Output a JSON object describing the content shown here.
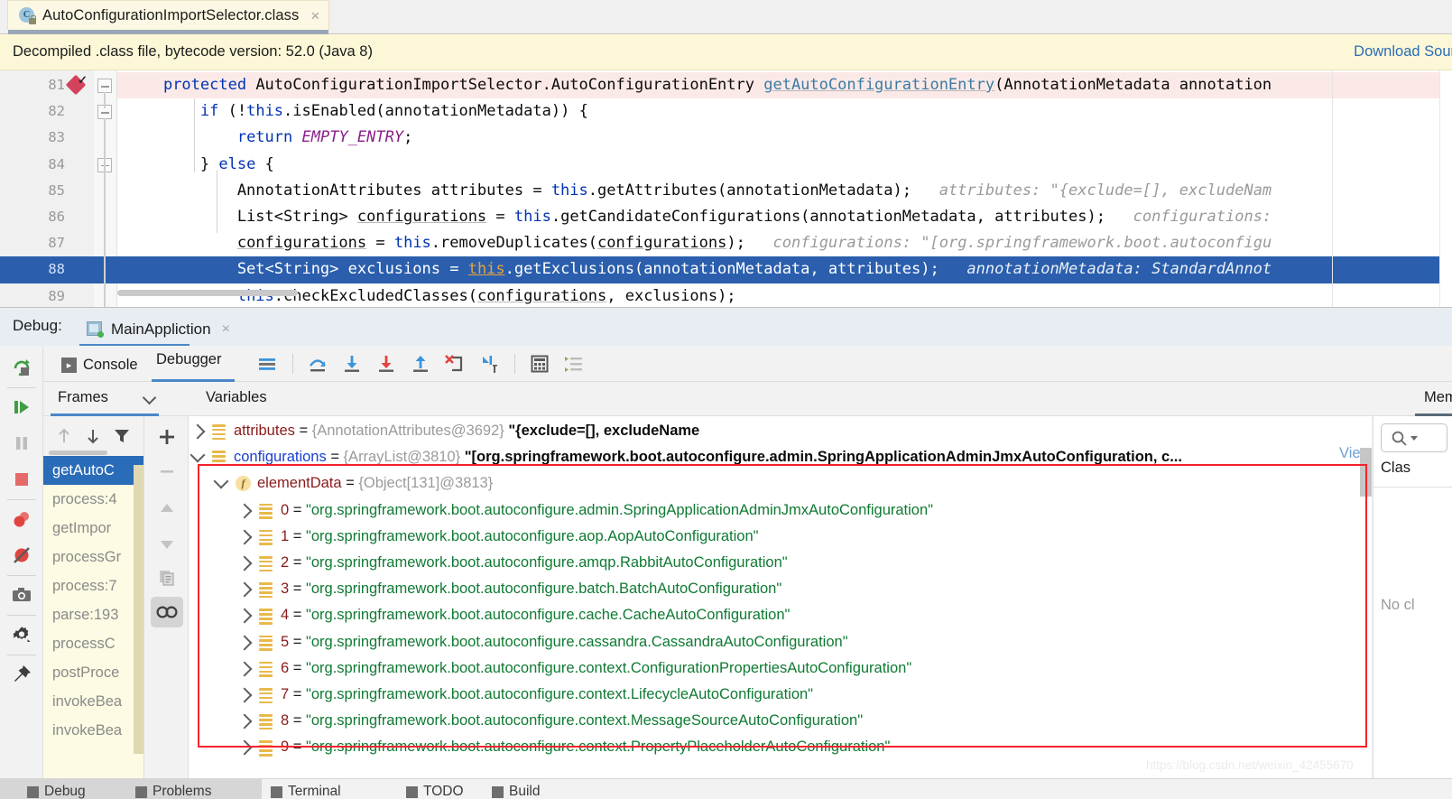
{
  "editor_tab": {
    "title": "AutoConfigurationImportSelector.class",
    "icon": "java-class-locked-icon",
    "close": "×",
    "class_letter": "C"
  },
  "notice": {
    "text": "Decompiled .class file, bytecode version: 52.0 (Java 8)",
    "link": "Download Sour"
  },
  "code": {
    "lines": [
      {
        "num": "81",
        "state": "exec",
        "breakpoint": true,
        "fold": true,
        "segments": [
          {
            "t": "    ",
            "c": "plain"
          },
          {
            "t": "protected",
            "c": "kw"
          },
          {
            "t": " AutoConfigurationImportSelector.AutoConfigurationEntry ",
            "c": "plain"
          },
          {
            "t": "getAutoConfigurationEntry",
            "c": "mth-und"
          },
          {
            "t": "(AnnotationMetadata annotation",
            "c": "plain"
          }
        ]
      },
      {
        "num": "82",
        "state": "normal",
        "breakpoint": false,
        "fold": true,
        "segments": [
          {
            "t": "        ",
            "c": "plain"
          },
          {
            "t": "if",
            "c": "kw"
          },
          {
            "t": " (!",
            "c": "plain"
          },
          {
            "t": "this",
            "c": "kw"
          },
          {
            "t": ".isEnabled(annotationMetadata)) {",
            "c": "plain"
          }
        ]
      },
      {
        "num": "83",
        "state": "normal",
        "breakpoint": false,
        "fold": false,
        "segments": [
          {
            "t": "            ",
            "c": "plain"
          },
          {
            "t": "return",
            "c": "kw"
          },
          {
            "t": " ",
            "c": "plain"
          },
          {
            "t": "EMPTY_ENTRY",
            "c": "fld"
          },
          {
            "t": ";",
            "c": "plain"
          }
        ]
      },
      {
        "num": "84",
        "state": "normal",
        "breakpoint": false,
        "fold": true,
        "segments": [
          {
            "t": "        } ",
            "c": "plain"
          },
          {
            "t": "else",
            "c": "kw"
          },
          {
            "t": " {",
            "c": "plain"
          }
        ]
      },
      {
        "num": "85",
        "state": "normal",
        "breakpoint": false,
        "fold": false,
        "segments": [
          {
            "t": "            AnnotationAttributes attributes = ",
            "c": "plain"
          },
          {
            "t": "this",
            "c": "kw"
          },
          {
            "t": ".getAttributes(annotationMetadata);   ",
            "c": "plain"
          },
          {
            "t": "attributes: \"{exclude=[], excludeNam",
            "c": "cm"
          }
        ]
      },
      {
        "num": "86",
        "state": "normal",
        "breakpoint": false,
        "fold": false,
        "segments": [
          {
            "t": "            List<String> ",
            "c": "plain"
          },
          {
            "t": "configurations",
            "c": "und"
          },
          {
            "t": " = ",
            "c": "plain"
          },
          {
            "t": "this",
            "c": "kw"
          },
          {
            "t": ".getCandidateConfigurations(annotationMetadata, attributes);   ",
            "c": "plain"
          },
          {
            "t": "configurations:",
            "c": "cm"
          }
        ]
      },
      {
        "num": "87",
        "state": "normal",
        "breakpoint": false,
        "fold": false,
        "segments": [
          {
            "t": "            ",
            "c": "plain"
          },
          {
            "t": "configurations",
            "c": "und"
          },
          {
            "t": " = ",
            "c": "plain"
          },
          {
            "t": "this",
            "c": "kw"
          },
          {
            "t": ".removeDuplicates(",
            "c": "plain"
          },
          {
            "t": "configurations",
            "c": "und"
          },
          {
            "t": ");   ",
            "c": "plain"
          },
          {
            "t": "configurations: \"[org.springframework.boot.autoconfigu",
            "c": "cm"
          }
        ]
      },
      {
        "num": "88",
        "state": "current",
        "breakpoint": false,
        "fold": false,
        "segments": [
          {
            "t": "            Set<String> exclusions = ",
            "c": "white"
          },
          {
            "t": "this",
            "c": "hl-this"
          },
          {
            "t": ".getExclusions(annotationMetadata, attributes);   ",
            "c": "white"
          },
          {
            "t": "annotationMetadata: StandardAnnot",
            "c": "white-italic"
          }
        ]
      },
      {
        "num": "89",
        "state": "normal",
        "breakpoint": false,
        "fold": false,
        "segments": [
          {
            "t": "            ",
            "c": "plain"
          },
          {
            "t": "this",
            "c": "kw"
          },
          {
            "t": ".checkExcludedClasses(",
            "c": "plain"
          },
          {
            "t": "configurations",
            "c": "und"
          },
          {
            "t": ", exclusions);",
            "c": "plain"
          }
        ]
      }
    ]
  },
  "debug": {
    "label": "Debug:",
    "session_tab": "MainAppliction",
    "session_close": "×",
    "console_tab": "Console",
    "debugger_tab": "Debugger",
    "frames_tab": "Frames",
    "variables_tab": "Variables",
    "memory_tab": "Mem",
    "toolbar_icons": [
      "mute-breakpoints-icon",
      "step-over-icon",
      "step-into-icon",
      "force-step-into-icon",
      "step-out-icon",
      "drop-frame-icon",
      "run-to-cursor-icon",
      "evaluate-expression-icon",
      "settings-lines-icon"
    ],
    "left_toolbar_icons": [
      "rerun-icon",
      "resume-program-icon",
      "pause-program-icon",
      "stop-icon",
      "view-breakpoints-icon",
      "mute-breakpoints-icon",
      "screenshot-icon",
      "settings-gear-icon",
      "pin-icon"
    ],
    "frames_toolbar_icons": [
      "up-arrow-icon",
      "down-arrow-icon",
      "filter-icon"
    ],
    "vars_toolbar_icons": [
      "add-watch-icon",
      "remove-watch-icon",
      "move-up-icon",
      "move-down-icon",
      "copy-icon",
      "inspect-icon"
    ],
    "frames": [
      {
        "label": "getAutoC",
        "selected": true
      },
      {
        "label": "process:4",
        "selected": false
      },
      {
        "label": "getImpor",
        "selected": false
      },
      {
        "label": "processGr",
        "selected": false
      },
      {
        "label": "process:7",
        "selected": false
      },
      {
        "label": "parse:193",
        "selected": false
      },
      {
        "label": "processC",
        "selected": false
      },
      {
        "label": "postProce",
        "selected": false
      },
      {
        "label": "invokeBea",
        "selected": false
      },
      {
        "label": "invokeBea",
        "selected": false
      }
    ]
  },
  "variables": {
    "view_link": "View",
    "rows": [
      {
        "indent": 0,
        "arrow": "collapsed",
        "icon": "list-icon",
        "name": "attributes",
        "name_color": "dark-red",
        "type": "{AnnotationAttributes@3692}",
        "value": "\"{exclude=[], excludeName",
        "value_color": "dark"
      },
      {
        "indent": 0,
        "arrow": "expanded",
        "icon": "list-icon",
        "name": "configurations",
        "name_color": "blue",
        "type": "{ArrayList@3810}",
        "value": "\"[org.springframework.boot.autoconfigure.admin.SpringApplicationAdminJmxAutoConfiguration, c...",
        "value_color": "dark"
      },
      {
        "indent": 1,
        "arrow": "expanded",
        "icon": "field-icon",
        "name": "elementData",
        "name_color": "dark-red",
        "type": "{Object[131]@3813}",
        "value": "",
        "value_color": "dark"
      },
      {
        "indent": 2,
        "arrow": "collapsed",
        "icon": "list-icon",
        "name": "0",
        "name_color": "dark-red",
        "type": "",
        "value": "\"org.springframework.boot.autoconfigure.admin.SpringApplicationAdminJmxAutoConfiguration\"",
        "value_color": "green"
      },
      {
        "indent": 2,
        "arrow": "collapsed",
        "icon": "list-icon",
        "name": "1",
        "name_color": "dark-red",
        "type": "",
        "value": "\"org.springframework.boot.autoconfigure.aop.AopAutoConfiguration\"",
        "value_color": "green"
      },
      {
        "indent": 2,
        "arrow": "collapsed",
        "icon": "list-icon",
        "name": "2",
        "name_color": "dark-red",
        "type": "",
        "value": "\"org.springframework.boot.autoconfigure.amqp.RabbitAutoConfiguration\"",
        "value_color": "green"
      },
      {
        "indent": 2,
        "arrow": "collapsed",
        "icon": "list-icon",
        "name": "3",
        "name_color": "dark-red",
        "type": "",
        "value": "\"org.springframework.boot.autoconfigure.batch.BatchAutoConfiguration\"",
        "value_color": "green"
      },
      {
        "indent": 2,
        "arrow": "collapsed",
        "icon": "list-icon",
        "name": "4",
        "name_color": "dark-red",
        "type": "",
        "value": "\"org.springframework.boot.autoconfigure.cache.CacheAutoConfiguration\"",
        "value_color": "green"
      },
      {
        "indent": 2,
        "arrow": "collapsed",
        "icon": "list-icon",
        "name": "5",
        "name_color": "dark-red",
        "type": "",
        "value": "\"org.springframework.boot.autoconfigure.cassandra.CassandraAutoConfiguration\"",
        "value_color": "green"
      },
      {
        "indent": 2,
        "arrow": "collapsed",
        "icon": "list-icon",
        "name": "6",
        "name_color": "dark-red",
        "type": "",
        "value": "\"org.springframework.boot.autoconfigure.context.ConfigurationPropertiesAutoConfiguration\"",
        "value_color": "green"
      },
      {
        "indent": 2,
        "arrow": "collapsed",
        "icon": "list-icon",
        "name": "7",
        "name_color": "dark-red",
        "type": "",
        "value": "\"org.springframework.boot.autoconfigure.context.LifecycleAutoConfiguration\"",
        "value_color": "green"
      },
      {
        "indent": 2,
        "arrow": "collapsed",
        "icon": "list-icon",
        "name": "8",
        "name_color": "dark-red",
        "type": "",
        "value": "\"org.springframework.boot.autoconfigure.context.MessageSourceAutoConfiguration\"",
        "value_color": "green"
      },
      {
        "indent": 2,
        "arrow": "collapsed",
        "icon": "list-icon",
        "name": "9",
        "name_color": "dark-red",
        "type": "",
        "value": "\"org.springframework.boot.autoconfigure.context.PropertyPlaceholderAutoConfiguration\"",
        "value_color": "green"
      }
    ]
  },
  "memory": {
    "search_placeholder": "",
    "column_header": "Clas",
    "empty_text": "No cl"
  },
  "statusbar": {
    "items": [
      "Debug",
      "Problems",
      "Terminal",
      "TODO",
      "Build"
    ]
  },
  "watermark": "https://blog.csdn.net/weixin_42455670",
  "colors": {
    "accent_blue": "#2b6cb8",
    "highlight_row": "#2b5fad",
    "exec_row": "#fbe9e7",
    "notice_bg": "#fcf8d7",
    "redbox": "#f5222d",
    "string_green": "#0f7a33"
  }
}
